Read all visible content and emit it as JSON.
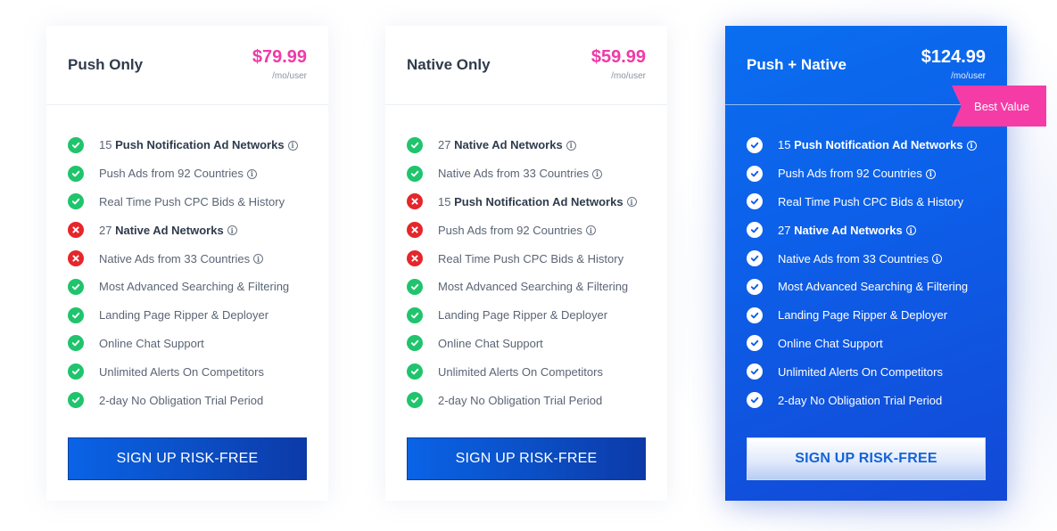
{
  "colors": {
    "accent_pink": "#f03aa8",
    "check_green": "#1fc46d",
    "cross_red": "#e5262b",
    "featured_blue": "#0d5ee8"
  },
  "plans": [
    {
      "name": "Push Only",
      "price": "$79.99",
      "per": "/mo/user",
      "cta": "SIGN UP RISK-FREE",
      "features": [
        {
          "ok": true,
          "pre": "15 ",
          "bold": "Push Notification Ad Networks",
          "post": "",
          "info": true,
          "icon": "check-icon"
        },
        {
          "ok": true,
          "pre": "Push Ads from 92 Countries",
          "bold": "",
          "post": "",
          "info": true,
          "icon": "check-icon"
        },
        {
          "ok": true,
          "pre": "Real Time Push CPC Bids & History",
          "bold": "",
          "post": "",
          "info": false,
          "icon": "check-icon"
        },
        {
          "ok": false,
          "pre": "27 ",
          "bold": "Native Ad Networks",
          "post": "",
          "info": true,
          "icon": "cross-icon"
        },
        {
          "ok": false,
          "pre": "Native Ads from 33 Countries",
          "bold": "",
          "post": "",
          "info": true,
          "icon": "cross-icon"
        },
        {
          "ok": true,
          "pre": "Most Advanced Searching & Filtering",
          "bold": "",
          "post": "",
          "info": false,
          "icon": "check-icon"
        },
        {
          "ok": true,
          "pre": "Landing Page Ripper & Deployer",
          "bold": "",
          "post": "",
          "info": false,
          "icon": "check-icon"
        },
        {
          "ok": true,
          "pre": "Online Chat Support",
          "bold": "",
          "post": "",
          "info": false,
          "icon": "check-icon"
        },
        {
          "ok": true,
          "pre": "Unlimited Alerts On Competitors",
          "bold": "",
          "post": "",
          "info": false,
          "icon": "check-icon"
        },
        {
          "ok": true,
          "pre": "2-day No Obligation Trial Period",
          "bold": "",
          "post": "",
          "info": false,
          "icon": "check-icon"
        }
      ]
    },
    {
      "name": "Native Only",
      "price": "$59.99",
      "per": "/mo/user",
      "cta": "SIGN UP RISK-FREE",
      "features": [
        {
          "ok": true,
          "pre": "27 ",
          "bold": "Native Ad Networks",
          "post": "",
          "info": true,
          "icon": "check-icon"
        },
        {
          "ok": true,
          "pre": "Native Ads from 33 Countries",
          "bold": "",
          "post": "",
          "info": true,
          "icon": "check-icon"
        },
        {
          "ok": false,
          "pre": "15 ",
          "bold": "Push Notification Ad Networks",
          "post": "",
          "info": true,
          "icon": "cross-icon"
        },
        {
          "ok": false,
          "pre": "Push Ads from 92 Countries",
          "bold": "",
          "post": "",
          "info": true,
          "icon": "cross-icon"
        },
        {
          "ok": false,
          "pre": "Real Time Push CPC Bids & History",
          "bold": "",
          "post": "",
          "info": false,
          "icon": "cross-icon"
        },
        {
          "ok": true,
          "pre": "Most Advanced Searching & Filtering",
          "bold": "",
          "post": "",
          "info": false,
          "icon": "check-icon"
        },
        {
          "ok": true,
          "pre": "Landing Page Ripper & Deployer",
          "bold": "",
          "post": "",
          "info": false,
          "icon": "check-icon"
        },
        {
          "ok": true,
          "pre": "Online Chat Support",
          "bold": "",
          "post": "",
          "info": false,
          "icon": "check-icon"
        },
        {
          "ok": true,
          "pre": "Unlimited Alerts On Competitors",
          "bold": "",
          "post": "",
          "info": false,
          "icon": "check-icon"
        },
        {
          "ok": true,
          "pre": "2-day No Obligation Trial Period",
          "bold": "",
          "post": "",
          "info": false,
          "icon": "check-icon"
        }
      ]
    },
    {
      "name": "Push + Native",
      "price": "$124.99",
      "per": "/mo/user",
      "badge": "Best Value",
      "cta": "SIGN UP RISK-FREE",
      "features": [
        {
          "ok": true,
          "pre": "15 ",
          "bold": "Push Notification Ad Networks",
          "post": "",
          "info": true,
          "icon": "check-icon"
        },
        {
          "ok": true,
          "pre": "Push Ads from 92 Countries",
          "bold": "",
          "post": "",
          "info": true,
          "icon": "check-icon"
        },
        {
          "ok": true,
          "pre": "Real Time Push CPC Bids & History",
          "bold": "",
          "post": "",
          "info": false,
          "icon": "check-icon"
        },
        {
          "ok": true,
          "pre": "27 ",
          "bold": "Native Ad Networks",
          "post": "",
          "info": true,
          "icon": "check-icon"
        },
        {
          "ok": true,
          "pre": "Native Ads from 33 Countries",
          "bold": "",
          "post": "",
          "info": true,
          "icon": "check-icon"
        },
        {
          "ok": true,
          "pre": "Most Advanced Searching & Filtering",
          "bold": "",
          "post": "",
          "info": false,
          "icon": "check-icon"
        },
        {
          "ok": true,
          "pre": "Landing Page Ripper & Deployer",
          "bold": "",
          "post": "",
          "info": false,
          "icon": "check-icon"
        },
        {
          "ok": true,
          "pre": "Online Chat Support",
          "bold": "",
          "post": "",
          "info": false,
          "icon": "check-icon"
        },
        {
          "ok": true,
          "pre": "Unlimited Alerts On Competitors",
          "bold": "",
          "post": "",
          "info": false,
          "icon": "check-icon"
        },
        {
          "ok": true,
          "pre": "2-day No Obligation Trial Period",
          "bold": "",
          "post": "",
          "info": false,
          "icon": "check-icon"
        }
      ]
    }
  ]
}
